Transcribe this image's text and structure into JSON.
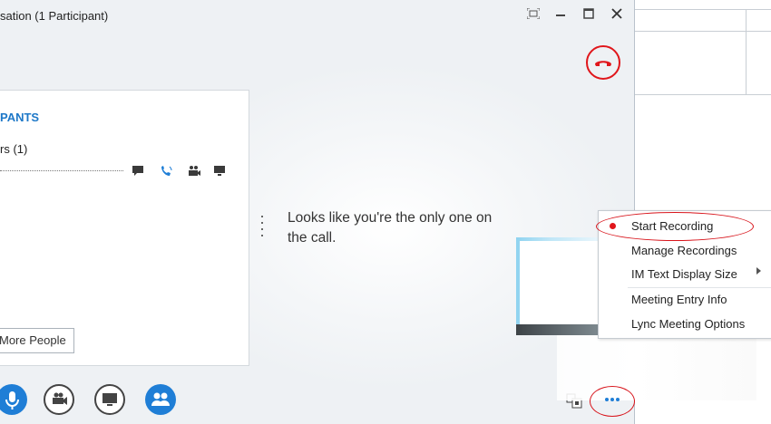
{
  "window": {
    "title": "sation (1 Participant)",
    "controls": [
      "fullscreen-icon",
      "minimize-icon",
      "maximize-icon",
      "close-icon"
    ]
  },
  "participants": {
    "heading": "PANTS",
    "group_label": "rs (1)",
    "more_people_label": "More People"
  },
  "stage": {
    "message": "Looks like you're the only one on the call."
  },
  "menu": {
    "items": [
      {
        "label": "Start Recording"
      },
      {
        "label": "Manage Recordings"
      },
      {
        "label": "IM Text Display Size"
      },
      {
        "label": "Meeting Entry Info"
      },
      {
        "label": "Lync Meeting Options"
      }
    ]
  },
  "colors": {
    "accent": "#1f7ed6",
    "hangup_red": "#e0161b",
    "annotation_red": "#d8141b"
  }
}
